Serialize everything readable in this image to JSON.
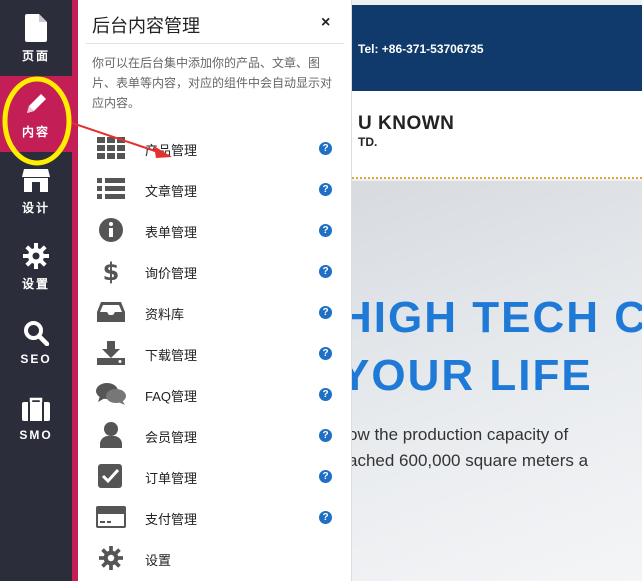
{
  "rail": {
    "items": [
      {
        "label": "页面",
        "icon": "page-icon"
      },
      {
        "label": "内容",
        "icon": "pencil-icon"
      },
      {
        "label": "设计",
        "icon": "store-icon"
      },
      {
        "label": "设置",
        "icon": "gear-icon"
      },
      {
        "label": "SEO",
        "icon": "search-icon"
      },
      {
        "label": "SMO",
        "icon": "briefcase-icon"
      }
    ]
  },
  "panel": {
    "title": "后台内容管理",
    "close": "×",
    "description": "你可以在后台集中添加你的产品、文章、图片、表单等内容，对应的组件中会自动显示对应内容。",
    "items": [
      {
        "label": "产品管理",
        "icon": "grid-icon",
        "help": "?"
      },
      {
        "label": "文章管理",
        "icon": "list-icon",
        "help": "?"
      },
      {
        "label": "表单管理",
        "icon": "info-icon",
        "help": "?"
      },
      {
        "label": "询价管理",
        "icon": "dollar-icon",
        "help": "?"
      },
      {
        "label": "资料库",
        "icon": "inbox-icon",
        "help": "?"
      },
      {
        "label": "下载管理",
        "icon": "download-icon",
        "help": "?"
      },
      {
        "label": "FAQ管理",
        "icon": "chat-icon",
        "help": "?"
      },
      {
        "label": "会员管理",
        "icon": "user-icon",
        "help": "?"
      },
      {
        "label": "订单管理",
        "icon": "checkbox-icon",
        "help": "?"
      },
      {
        "label": "支付管理",
        "icon": "credit-card-icon",
        "help": "?"
      },
      {
        "label": "设置",
        "icon": "gear-icon",
        "help": ""
      }
    ]
  },
  "site": {
    "tel": "Tel: +86-371-53706735",
    "brand_line1": "U KNOWN",
    "brand_line2": "TD.",
    "hero_line1": "HIGH TECH C",
    "hero_line2": "YOUR LIFE",
    "hero_text1": "ow the production capacity of",
    "hero_text2": "ached 600,000 square meters a"
  },
  "colors": {
    "rail_bg": "#2b2d3a",
    "accent": "#c41e57",
    "help": "#1f6fc5",
    "hero_blue": "#1e7ad6",
    "annotation_circle": "#ffee00",
    "annotation_arrow": "#e53030"
  }
}
